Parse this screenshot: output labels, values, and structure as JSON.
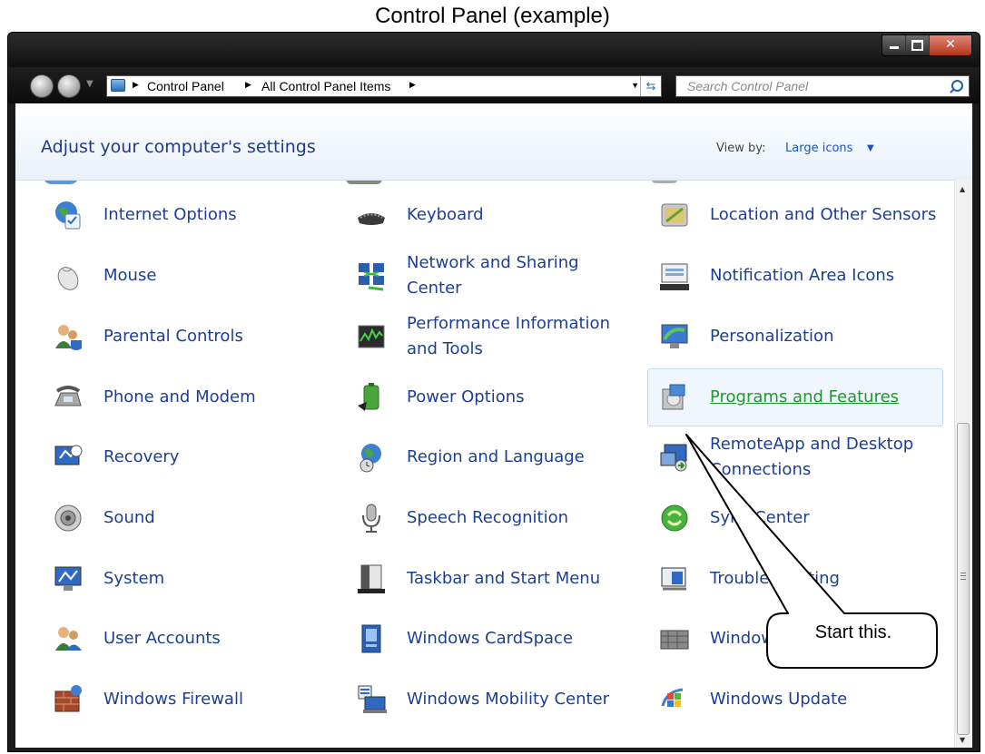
{
  "caption": "Control Panel (example)",
  "window": {
    "address": {
      "segments": [
        "Control Panel",
        "All Control Panel Items"
      ]
    },
    "search_placeholder": "Search Control Panel"
  },
  "header": {
    "title": "Adjust your computer's settings",
    "view_by_label": "View by:",
    "view_by_value": "Large icons"
  },
  "items": [
    {
      "label": "Internet Options",
      "icon": "internet-options-icon"
    },
    {
      "label": "Keyboard",
      "icon": "keyboard-icon"
    },
    {
      "label": "Location and Other Sensors",
      "icon": "location-sensors-icon"
    },
    {
      "label": "Mouse",
      "icon": "mouse-icon"
    },
    {
      "label": "Network and Sharing Center",
      "icon": "network-icon"
    },
    {
      "label": "Notification Area Icons",
      "icon": "notification-area-icon"
    },
    {
      "label": "Parental Controls",
      "icon": "parental-controls-icon"
    },
    {
      "label": "Performance Information and Tools",
      "icon": "performance-icon"
    },
    {
      "label": "Personalization",
      "icon": "personalization-icon"
    },
    {
      "label": "Phone and Modem",
      "icon": "phone-modem-icon"
    },
    {
      "label": "Power Options",
      "icon": "power-options-icon"
    },
    {
      "label": "Programs and Features",
      "icon": "programs-features-icon",
      "hovered": true
    },
    {
      "label": "Recovery",
      "icon": "recovery-icon"
    },
    {
      "label": "Region and Language",
      "icon": "region-language-icon"
    },
    {
      "label": "RemoteApp and Desktop Connections",
      "icon": "remoteapp-icon"
    },
    {
      "label": "Sound",
      "icon": "sound-icon"
    },
    {
      "label": "Speech Recognition",
      "icon": "speech-recognition-icon"
    },
    {
      "label": "Sync Center",
      "icon": "sync-center-icon"
    },
    {
      "label": "System",
      "icon": "system-icon"
    },
    {
      "label": "Taskbar and Start Menu",
      "icon": "taskbar-icon"
    },
    {
      "label": "Troubleshooting",
      "icon": "troubleshooting-icon"
    },
    {
      "label": "User Accounts",
      "icon": "user-accounts-icon"
    },
    {
      "label": "Windows CardSpace",
      "icon": "cardspace-icon"
    },
    {
      "label": "Windows Defender",
      "icon": "defender-icon"
    },
    {
      "label": "Windows Firewall",
      "icon": "firewall-icon"
    },
    {
      "label": "Windows Mobility Center",
      "icon": "mobility-center-icon"
    },
    {
      "label": "Windows Update",
      "icon": "windows-update-icon"
    }
  ],
  "callout": {
    "text": "Start this."
  },
  "colors": {
    "link": "#1c3f94",
    "hover_link": "#1c9a2c",
    "header_title": "#1e3a8a"
  }
}
